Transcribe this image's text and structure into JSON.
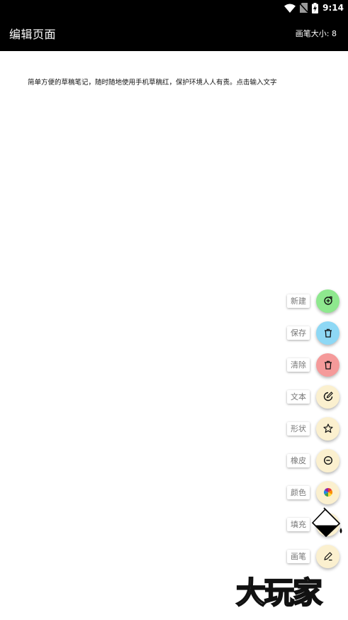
{
  "status_bar": {
    "time": "9:14",
    "icons": [
      "wifi-icon",
      "no-sim-icon",
      "battery-charging-icon"
    ]
  },
  "app_bar": {
    "title": "编辑页面",
    "brush_size_label": "画笔大小: 8"
  },
  "canvas": {
    "text": "简单方便的草稿笔记，随时随地使用手机草稿红，保护环境人人有责。点击输入文字"
  },
  "fab_menu": {
    "items": [
      {
        "id": "new",
        "label": "新建",
        "icon": "new-icon",
        "color": "#8ee88e"
      },
      {
        "id": "save",
        "label": "保存",
        "icon": "trash-icon",
        "color": "#8ed8f5"
      },
      {
        "id": "clear",
        "label": "清除",
        "icon": "trash-icon",
        "color": "#f59a9a"
      },
      {
        "id": "text",
        "label": "文本",
        "icon": "edit-icon",
        "color": "#fbf0cf"
      },
      {
        "id": "shape",
        "label": "形状",
        "icon": "star-icon",
        "color": "#fbf0cf"
      },
      {
        "id": "eraser",
        "label": "橡皮",
        "icon": "minus-circle-icon",
        "color": "#fbf0cf"
      },
      {
        "id": "color",
        "label": "颜色",
        "icon": "color-wheel-icon",
        "color": "#fbf0cf"
      },
      {
        "id": "fill",
        "label": "填充",
        "icon": "paint-bucket-icon",
        "color": "#fbf0cf"
      },
      {
        "id": "brush",
        "label": "画笔",
        "icon": "pen-icon",
        "color": "#fbf0cf"
      }
    ]
  },
  "watermark": {
    "text": "大玩家"
  }
}
